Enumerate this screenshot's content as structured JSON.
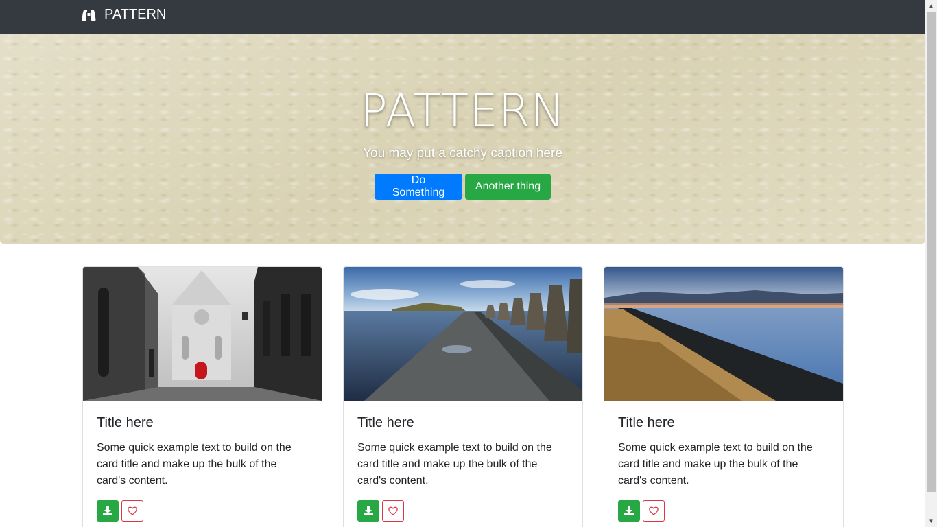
{
  "navbar": {
    "brand_icon": "binoculars-icon",
    "brand_label": "PATTERN"
  },
  "hero": {
    "title": "PATTERN",
    "caption": "You may put a catchy caption here",
    "primary_button": "Do Something",
    "secondary_button": "Another thing"
  },
  "cards": [
    {
      "image": "photo-black-white-alley-with-red-door",
      "title": "Title here",
      "text": "Some quick example text to build on the card title and make up the bulk of the card's content.",
      "download_icon": "download-icon",
      "favorite_icon": "heart-icon"
    },
    {
      "image": "photo-causeway-concrete-pylons-by-water",
      "title": "Title here",
      "text": "Some quick example text to build on the card title and make up the bulk of the card's content.",
      "download_icon": "download-icon",
      "favorite_icon": "heart-icon"
    },
    {
      "image": "photo-lake-shore-sunset-with-dry-grass",
      "title": "Title here",
      "text": "Some quick example text to build on the card title and make up the bulk of the card's content.",
      "download_icon": "download-icon",
      "favorite_icon": "heart-icon"
    }
  ],
  "colors": {
    "navbar": "#343a40",
    "primary": "#007bff",
    "success": "#28a745",
    "danger": "#dc3545",
    "hero_background": "#dcd6ba"
  }
}
